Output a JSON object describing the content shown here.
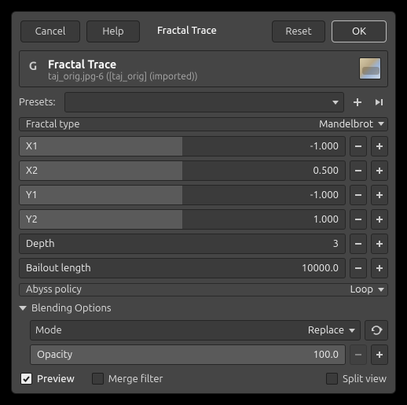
{
  "buttons": {
    "cancel": "Cancel",
    "help": "Help",
    "title": "Fractal Trace",
    "reset": "Reset",
    "ok": "OK"
  },
  "header": {
    "title": "Fractal Trace",
    "subtitle": "taj_orig.jpg-6 ([taj_orig] (imported))"
  },
  "presets": {
    "label": "Presets:"
  },
  "fractal_type": {
    "label": "Fractal type",
    "value": "Mandelbrot"
  },
  "params": {
    "x1": {
      "label": "X1",
      "value": "-1.000",
      "fill": "50%"
    },
    "x2": {
      "label": "X2",
      "value": "0.500",
      "fill": "50%"
    },
    "y1": {
      "label": "Y1",
      "value": "-1.000",
      "fill": "50%"
    },
    "y2": {
      "label": "Y2",
      "value": "1.000",
      "fill": "50%"
    },
    "depth": {
      "label": "Depth",
      "value": "3",
      "fill": "0%"
    },
    "bailout": {
      "label": "Bailout length",
      "value": "10000.0",
      "fill": "0%"
    }
  },
  "abyss": {
    "label": "Abyss policy",
    "value": "Loop"
  },
  "blending": {
    "title": "Blending Options",
    "mode": {
      "label": "Mode",
      "value": "Replace"
    },
    "opacity": {
      "label": "Opacity",
      "value": "100.0",
      "fill": "100%"
    }
  },
  "footer": {
    "preview": "Preview",
    "merge": "Merge filter",
    "split": "Split view"
  }
}
